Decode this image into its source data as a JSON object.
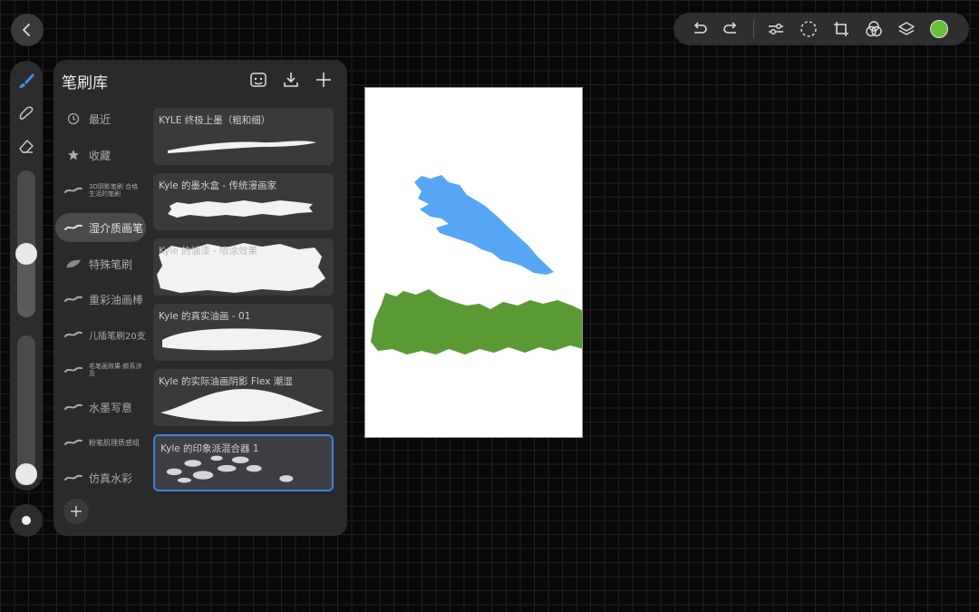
{
  "colors": {
    "accent": "#3f7fe0",
    "current_color": "#6abf3a",
    "blue_stroke": "#56a6f5",
    "green_stroke": "#5a9a34"
  },
  "toolbar": {
    "icons": [
      "undo-icon",
      "redo-icon",
      "adjustments-icon",
      "selection-icon",
      "transform-icon",
      "blend-icon",
      "layers-icon"
    ]
  },
  "rail": {
    "tools": [
      "brush-icon",
      "smudge-icon",
      "eraser-icon"
    ],
    "size_slider": {
      "value": 0.42
    },
    "opacity_slider": {
      "value": 0.0
    }
  },
  "brush_library": {
    "title": "笔刷库",
    "categories": [
      {
        "label": "最近",
        "icon": "clock-icon"
      },
      {
        "label": "收藏",
        "icon": "star-icon"
      },
      {
        "label": "3D阴影笔刷 合格 生活的笔刷",
        "icon": "stroke-icon"
      },
      {
        "label": "湿介质画笔",
        "icon": "stroke-icon",
        "active": true
      },
      {
        "label": "特殊笔刷",
        "icon": "leaf-icon"
      },
      {
        "label": "重彩油画棒",
        "icon": "stroke-icon"
      },
      {
        "label": "儿插笔刷20支",
        "icon": "stroke-icon"
      },
      {
        "label": "毛笔画效果-颜系涉及",
        "icon": "stroke-icon"
      },
      {
        "label": "水墨写意",
        "icon": "stroke-icon"
      },
      {
        "label": "粉笔肌理质感组",
        "icon": "stroke-icon"
      },
      {
        "label": "仿真水彩",
        "icon": "stroke-icon"
      }
    ],
    "brushes": [
      {
        "name": "KYLE 终极上墨（粗和细）"
      },
      {
        "name": "Kyle 的墨水盒 - 传统漫画家"
      },
      {
        "name": "Kyle 的油漆 - 喷涂效果"
      },
      {
        "name": "Kyle 的真实油画 - 01"
      },
      {
        "name": "Kyle 的实际油画阴影 Flex 潮湿"
      },
      {
        "name": "Kyle 的印象派混合器 1",
        "selected": true
      }
    ]
  }
}
